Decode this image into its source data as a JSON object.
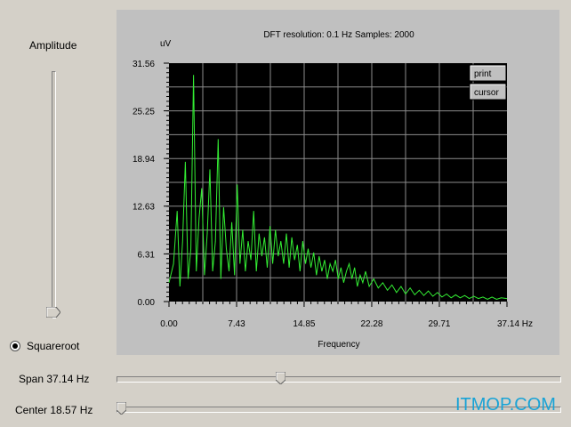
{
  "amplitude": {
    "label": "Amplitude",
    "level": 0.0
  },
  "squareroot": {
    "label": "Squareroot",
    "checked": true
  },
  "span": {
    "label": "Span 37.14 Hz",
    "position": 0.37
  },
  "center": {
    "label": "Center 18.57 Hz",
    "position": 0.0
  },
  "plot": {
    "header": "DFT resolution: 0.1 Hz   Samples: 2000",
    "unit": "uV",
    "print_label": "print",
    "cursor_label": "cursor"
  },
  "watermark": "ITMOP.COM",
  "colors": {
    "background": "#d4d0c8",
    "plot_bg": "#000000",
    "trace": "#33ee33",
    "grid": "#8c8c8c",
    "watermark": "#19a3d6"
  },
  "chart_data": {
    "type": "line",
    "title": "",
    "xlabel": "Frequency",
    "ylabel": "uV",
    "xlim": [
      0,
      37.14
    ],
    "ylim": [
      0,
      31.56
    ],
    "x_ticks": [
      "0.00",
      "7.43",
      "14.85",
      "22.28",
      "29.71",
      "37.14 Hz"
    ],
    "x_tick_values": [
      0,
      7.43,
      14.85,
      22.28,
      29.71,
      37.14
    ],
    "y_ticks": [
      "31.56",
      "25.25",
      "18.94",
      "12.63",
      "6.31",
      "0.00"
    ],
    "y_tick_values": [
      31.56,
      25.25,
      18.94,
      12.63,
      6.31,
      0
    ],
    "grid": true,
    "series": [
      {
        "x": [
          0.0,
          0.5,
          0.9,
          1.2,
          1.5,
          1.8,
          2.1,
          2.4,
          2.7,
          3.0,
          3.3,
          3.6,
          3.9,
          4.2,
          4.5,
          4.8,
          5.1,
          5.4,
          5.7,
          6.0,
          6.3,
          6.6,
          6.9,
          7.2,
          7.5,
          7.8,
          8.1,
          8.4,
          8.7,
          9.0,
          9.3,
          9.6,
          9.9,
          10.2,
          10.5,
          10.8,
          11.1,
          11.4,
          11.7,
          12.0,
          12.3,
          12.6,
          12.9,
          13.2,
          13.5,
          13.8,
          14.1,
          14.4,
          14.7,
          15.0,
          15.3,
          15.6,
          15.9,
          16.2,
          16.5,
          16.8,
          17.1,
          17.4,
          17.7,
          18.0,
          18.3,
          18.6,
          18.9,
          19.2,
          19.5,
          19.8,
          20.1,
          20.4,
          20.7,
          21.0,
          21.3,
          21.6,
          22.0,
          22.5,
          23.0,
          23.5,
          24.0,
          24.5,
          25.0,
          25.5,
          26.0,
          26.5,
          27.0,
          27.5,
          28.0,
          28.5,
          29.0,
          29.5,
          30.0,
          30.5,
          31.0,
          31.5,
          32.0,
          32.5,
          33.0,
          33.5,
          34.0,
          34.5,
          35.0,
          35.5,
          36.0,
          36.5,
          37.14
        ],
        "values": [
          2.5,
          5.0,
          12.0,
          2.0,
          8.0,
          18.5,
          3.0,
          7.0,
          30.0,
          4.0,
          11.0,
          15.0,
          3.5,
          9.0,
          17.5,
          4.0,
          8.0,
          21.5,
          3.0,
          12.5,
          7.0,
          4.0,
          10.5,
          3.5,
          15.5,
          5.0,
          9.5,
          4.0,
          8.0,
          5.5,
          12.0,
          4.0,
          9.0,
          6.0,
          8.5,
          4.5,
          10.0,
          5.0,
          9.5,
          6.0,
          8.0,
          5.0,
          9.0,
          4.5,
          8.5,
          5.5,
          7.5,
          4.0,
          8.0,
          5.0,
          7.0,
          4.5,
          6.5,
          3.5,
          6.0,
          4.0,
          5.5,
          3.0,
          5.0,
          4.0,
          5.5,
          3.0,
          4.5,
          2.5,
          4.0,
          5.0,
          3.0,
          4.5,
          2.0,
          3.5,
          2.5,
          4.0,
          2.0,
          3.0,
          1.8,
          2.5,
          1.5,
          2.2,
          1.2,
          2.0,
          1.0,
          1.8,
          0.9,
          1.5,
          0.8,
          1.4,
          0.7,
          1.2,
          0.6,
          1.0,
          0.5,
          0.9,
          0.5,
          0.8,
          0.4,
          0.7,
          0.4,
          0.6,
          0.3,
          0.6,
          0.3,
          0.5,
          0.4
        ]
      }
    ]
  }
}
